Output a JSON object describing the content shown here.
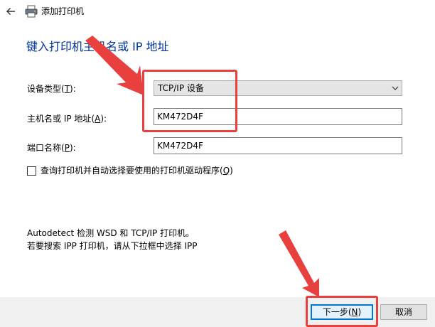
{
  "window": {
    "title": "添加打印机"
  },
  "heading": "键入打印机主机名或 IP 地址",
  "fields": {
    "device_type": {
      "label_prefix": "设备类型(",
      "label_key": "T",
      "label_suffix": "):",
      "value": "TCP/IP 设备"
    },
    "hostname": {
      "label_prefix": "主机名或 IP 地址(",
      "label_key": "A",
      "label_suffix": "):",
      "value": "KM472D4F"
    },
    "port_name": {
      "label_prefix": "端口名称(",
      "label_key": "P",
      "label_suffix": "):",
      "value": "KM472D4F"
    }
  },
  "checkbox": {
    "label_prefix": "查询打印机并自动选择要使用的打印机驱动程序(",
    "label_key": "Q",
    "label_suffix": ")",
    "checked": false
  },
  "info": {
    "line1": "Autodetect 检测 WSD 和 TCP/IP 打印机。",
    "line2": "若要搜索 IPP 打印机，请从下拉框中选择 IPP"
  },
  "buttons": {
    "next": {
      "label_prefix": "下一步(",
      "label_key": "N",
      "label_suffix": ")"
    },
    "cancel": {
      "label": "取消"
    }
  },
  "icons": {
    "back": "back-arrow-icon",
    "printer": "printer-icon",
    "dropdown": "chevron-down-icon"
  },
  "colors": {
    "heading": "#003399",
    "annotation": "#e8403f",
    "primary_button_border": "#0078d7",
    "footer_background": "#f0f0f0"
  }
}
